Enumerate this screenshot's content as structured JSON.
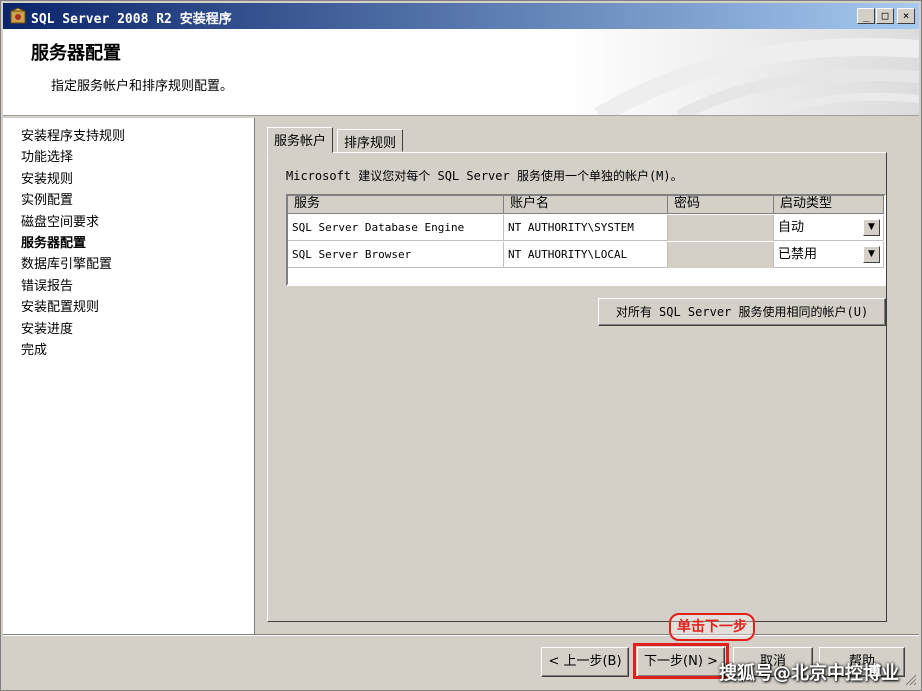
{
  "window": {
    "title": "SQL Server 2008 R2 安装程序",
    "controls": {
      "minimize": "_",
      "restore": "□",
      "close": "×"
    }
  },
  "header": {
    "title": "服务器配置",
    "subtitle": "指定服务帐户和排序规则配置。"
  },
  "sidebar": {
    "items": [
      {
        "label": "安装程序支持规则",
        "active": false
      },
      {
        "label": "功能选择",
        "active": false
      },
      {
        "label": "安装规则",
        "active": false
      },
      {
        "label": "实例配置",
        "active": false
      },
      {
        "label": "磁盘空间要求",
        "active": false
      },
      {
        "label": "服务器配置",
        "active": true
      },
      {
        "label": "数据库引擎配置",
        "active": false
      },
      {
        "label": "错误报告",
        "active": false
      },
      {
        "label": "安装配置规则",
        "active": false
      },
      {
        "label": "安装进度",
        "active": false
      },
      {
        "label": "完成",
        "active": false
      }
    ]
  },
  "tabs": [
    {
      "label": "服务帐户",
      "active": true
    },
    {
      "label": "排序规则",
      "active": false
    }
  ],
  "panel": {
    "recommendation": "Microsoft 建议您对每个 SQL Server 服务使用一个单独的帐户(M)。",
    "columns": [
      "服务",
      "账户名",
      "密码",
      "启动类型"
    ],
    "rows": [
      {
        "service": "SQL Server Database Engine",
        "account": "NT AUTHORITY\\SYSTEM",
        "password": "",
        "startup": "自动"
      },
      {
        "service": "SQL Server Browser",
        "account": "NT AUTHORITY\\LOCAL",
        "password": "",
        "startup": "已禁用"
      }
    ],
    "same_account_button": "对所有 SQL Server 服务使用相同的帐户(U)"
  },
  "footer": {
    "back_button": "< 上一步(B)",
    "next_button": "下一步(N) >",
    "cancel_button": "取消",
    "help_button": "帮助"
  },
  "annotation": {
    "callout": "单击下一步",
    "color": "#e0201c"
  },
  "watermark": "搜狐号@北京中控博业",
  "colors": {
    "title_gradient_start": "#0a246a",
    "title_gradient_end": "#a6caf0",
    "face": "#d4d0c8"
  }
}
